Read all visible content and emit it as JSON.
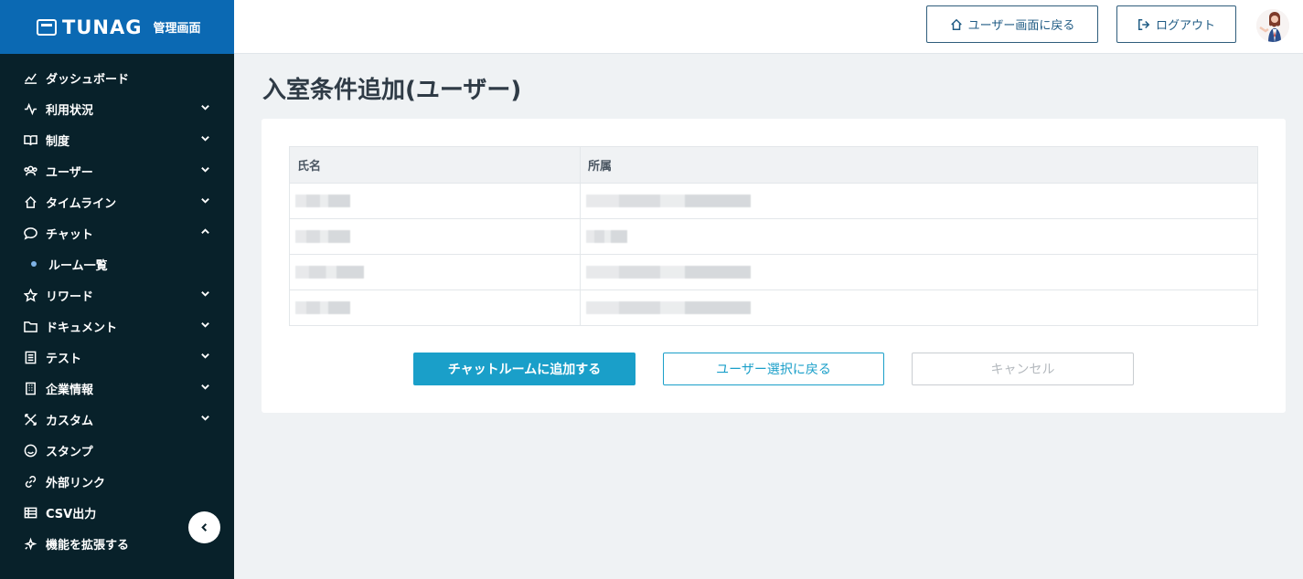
{
  "brand": {
    "logo_text": "TUNAG",
    "subtitle": "管理画面"
  },
  "header": {
    "home_label": "ユーザー画面に戻る",
    "logout_label": "ログアウト"
  },
  "sidebar": {
    "items": [
      {
        "label": "ダッシュボード",
        "icon": "chart-icon",
        "chevron": "none"
      },
      {
        "label": "利用状況",
        "icon": "activity-icon",
        "chevron": "down"
      },
      {
        "label": "制度",
        "icon": "book-icon",
        "chevron": "down"
      },
      {
        "label": "ユーザー",
        "icon": "users-icon",
        "chevron": "down"
      },
      {
        "label": "タイムライン",
        "icon": "home-icon",
        "chevron": "down"
      },
      {
        "label": "チャット",
        "icon": "chat-icon",
        "chevron": "up"
      },
      {
        "label": "リワード",
        "icon": "star-icon",
        "chevron": "down"
      },
      {
        "label": "ドキュメント",
        "icon": "folder-icon",
        "chevron": "down"
      },
      {
        "label": "テスト",
        "icon": "clipboard-icon",
        "chevron": "down"
      },
      {
        "label": "企業情報",
        "icon": "building-icon",
        "chevron": "down"
      },
      {
        "label": "カスタム",
        "icon": "tools-icon",
        "chevron": "down"
      },
      {
        "label": "スタンプ",
        "icon": "smile-icon",
        "chevron": "none"
      },
      {
        "label": "外部リンク",
        "icon": "link-icon",
        "chevron": "none"
      },
      {
        "label": "CSV出力",
        "icon": "table-icon",
        "chevron": "none"
      },
      {
        "label": "機能を拡張する",
        "icon": "sparkle-icon",
        "chevron": "none"
      }
    ],
    "chat_sub_item": "ルーム一覧"
  },
  "main": {
    "title": "入室条件追加(ユーザー)",
    "table": {
      "headers": [
        "氏名",
        "所属"
      ],
      "rows": [
        {
          "name_blur_width": 0.6,
          "dept_blur_width": 1.8
        },
        {
          "name_blur_width": 0.6,
          "dept_blur_width": 0.45
        },
        {
          "name_blur_width": 0.75,
          "dept_blur_width": 1.8
        },
        {
          "name_blur_width": 0.6,
          "dept_blur_width": 1.8
        }
      ]
    },
    "buttons": {
      "add": "チャットルームに追加する",
      "back": "ユーザー選択に戻る",
      "cancel": "キャンセル"
    }
  }
}
